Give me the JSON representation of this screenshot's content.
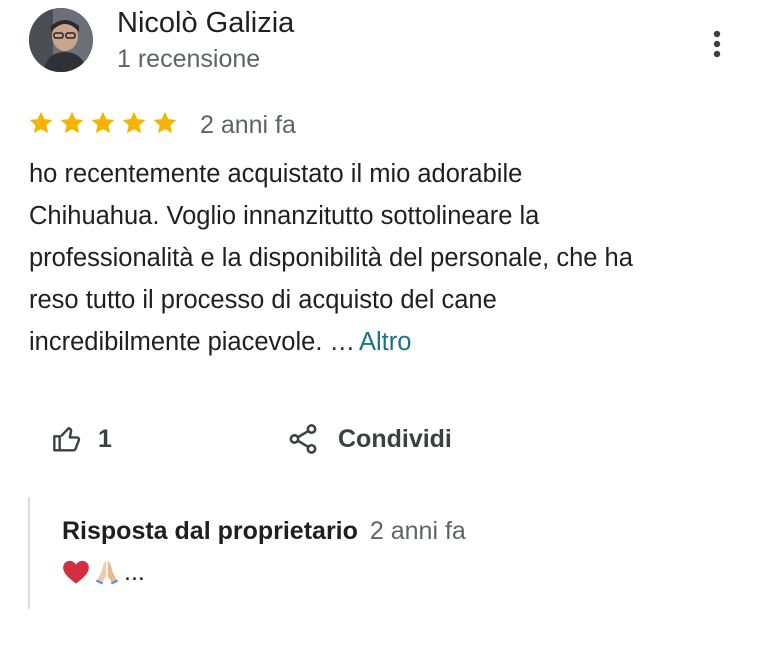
{
  "reviewer": {
    "name": "Nicolò Galizia",
    "meta": "1 recensione"
  },
  "review": {
    "rating": 5,
    "age": "2 anni fa",
    "lines": [
      "ho recentemente acquistato il mio adorabile",
      "Chihuahua. Voglio innanzitutto sottolineare la",
      "professionalità e la disponibilità del personale, che ha",
      "reso tutto il processo di acquisto del cane",
      "incredibilmente piacevole. …"
    ],
    "more_label": "Altro"
  },
  "actions": {
    "like_count": "1",
    "share_label": "Condividi"
  },
  "owner_reply": {
    "title": "Risposta dal proprietario",
    "age": "2 anni fa",
    "text_suffix": "..."
  },
  "colors": {
    "star": "#f4b400",
    "link": "#1a7387",
    "secondary_text": "#5f6368"
  }
}
